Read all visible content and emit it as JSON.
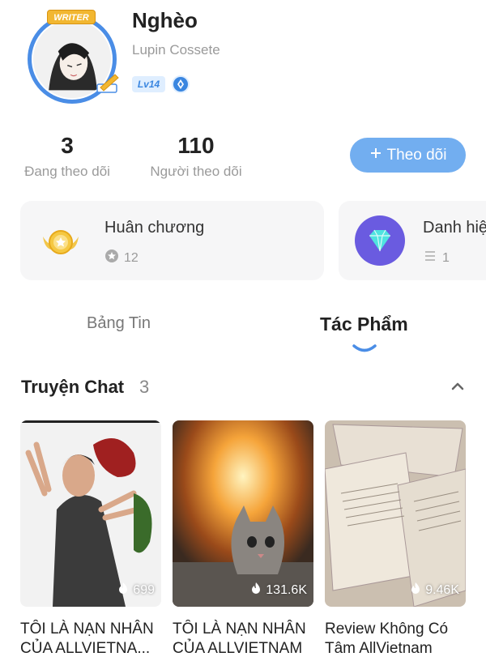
{
  "profile": {
    "name": "Nghèo",
    "subname": "Lupin Cossete",
    "level": "Lv14",
    "writer_badge": "WRITER"
  },
  "stats": {
    "following": {
      "value": "3",
      "label": "Đang theo dõi"
    },
    "followers": {
      "value": "110",
      "label": "Người theo dõi"
    }
  },
  "follow_button": {
    "label": "Theo dõi",
    "icon": "plus-icon"
  },
  "cards": [
    {
      "title": "Huân chương",
      "count": "12",
      "icon": "medal-icon"
    },
    {
      "title": "Danh hiệu",
      "count": "1",
      "icon": "diamond-icon"
    }
  ],
  "tabs": [
    {
      "label": "Bảng Tin",
      "active": false
    },
    {
      "label": "Tác Phẩm",
      "active": true
    }
  ],
  "section": {
    "title": "Truyện Chat",
    "count": "3"
  },
  "stories": [
    {
      "title": "TÔI LÀ NẠN NHÂN CỦA ALLVIETNA...",
      "views": "699"
    },
    {
      "title": "TÔI LÀ NẠN NHÂN CỦA ALLVIETNAM",
      "views": "131.6K"
    },
    {
      "title": "Review Không Có Tâm AllVietnam",
      "views": "9.46K"
    }
  ],
  "colors": {
    "accent": "#72aef0",
    "muted": "#9a9a9a",
    "card_bg": "#f6f6f7"
  }
}
